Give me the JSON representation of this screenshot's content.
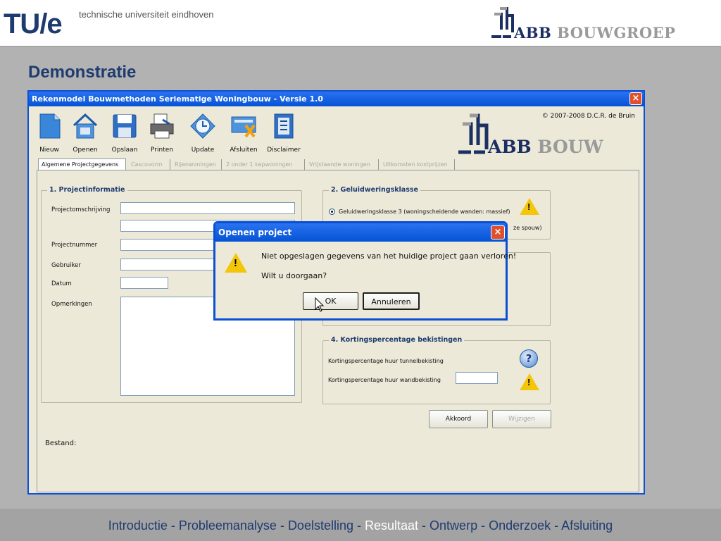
{
  "header": {
    "tue_logo": "TU/e",
    "tue_subtitle": "technische universiteit eindhoven",
    "abb_logo_text": "ABB BOUWGROEP",
    "abb_word": "ABB",
    "bouw_word": "BOUWGROEP"
  },
  "page_title": "Demonstratie",
  "app": {
    "title": "Rekenmodel Bouwmethoden Seriematige Woningbouw  -  Versie 1.0",
    "copyright": "© 2007-2008 D.C.R. de Bruin",
    "logo_abb": "ABB",
    "logo_bouw": "BOUW",
    "toolbar": [
      {
        "label": "Nieuw",
        "icon": "new-document-icon"
      },
      {
        "label": "Openen",
        "icon": "open-house-icon"
      },
      {
        "label": "Opslaan",
        "icon": "floppy-disk-icon"
      },
      {
        "label": "Printen",
        "icon": "printer-icon"
      },
      {
        "label": "Update",
        "icon": "update-clock-icon"
      },
      {
        "label": "Afsluiten",
        "icon": "exit-card-icon"
      },
      {
        "label": "Disclaimer",
        "icon": "disclaimer-document-icon"
      }
    ],
    "tabs": [
      {
        "label": "Algemene Projectgegevens",
        "active": true
      },
      {
        "label": "Cascovorm",
        "active": false
      },
      {
        "label": "Rijenwoningen",
        "active": false
      },
      {
        "label": "2 onder 1 kapwoningen",
        "active": false
      },
      {
        "label": "Vrijstaande woningen",
        "active": false
      },
      {
        "label": "Uitkomsten kostprijzen",
        "active": false
      }
    ],
    "group1": {
      "title": "1. Projectinformatie",
      "labels": {
        "projectomschrijving": "Projectomschrijving",
        "projectnummer": "Projectnummer",
        "gebruiker": "Gebruiker",
        "datum": "Datum",
        "opmerkingen": "Opmerkingen"
      },
      "values": {
        "projectomschrijving": "",
        "projectnummer": "",
        "gebruiker": "",
        "datum": "",
        "opmerkingen": ""
      }
    },
    "group2": {
      "title": "2. Geluidweringsklasse",
      "option1": "Geluidweringsklasse 3 (woningscheidende wanden: massief)",
      "option2_visible": "ze spouw)",
      "selected": 1
    },
    "group4": {
      "title": "4. Kortingspercentage bekistingen",
      "label_tunnel": "Kortingspercentage huur tunnelbekisting",
      "label_wand": "Kortingspercentage huur wandbekisting",
      "value_wand": ""
    },
    "buttons": {
      "akkoord": "Akkoord",
      "wijzigen": "Wijzigen"
    },
    "bestand_label": "Bestand:"
  },
  "dialog": {
    "title": "Openen project",
    "message1": "Niet opgeslagen gegevens van het huidige project gaan verloren!",
    "message2": "Wilt u doorgaan?",
    "ok": "OK",
    "cancel": "Annuleren"
  },
  "footer_nav": [
    {
      "label": "Introductie",
      "current": false
    },
    {
      "label": "Probleemanalyse",
      "current": false
    },
    {
      "label": "Doelstelling",
      "current": false
    },
    {
      "label": "Resultaat",
      "current": true
    },
    {
      "label": "Ontwerp",
      "current": false
    },
    {
      "label": "Onderzoek",
      "current": false
    },
    {
      "label": "Afsluiting",
      "current": false
    }
  ],
  "footer_separator": " - ",
  "colors": {
    "brand_blue": "#1e3b70",
    "xp_title": "#0553d6",
    "warning": "#f4c60a"
  }
}
